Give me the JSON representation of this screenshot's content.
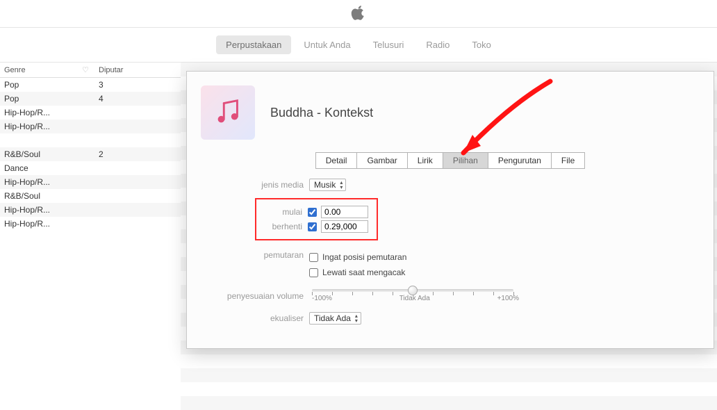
{
  "nav": {
    "items": [
      "Perpustakaan",
      "Untuk Anda",
      "Telusuri",
      "Radio",
      "Toko"
    ],
    "active_index": 0
  },
  "sidebar": {
    "columns": {
      "genre": "Genre",
      "heart": "♡",
      "plays": "Diputar"
    },
    "rows": [
      {
        "genre": "Pop",
        "plays": "3"
      },
      {
        "genre": "Pop",
        "plays": "4"
      },
      {
        "genre": "Hip-Hop/R...",
        "plays": ""
      },
      {
        "genre": "Hip-Hop/R...",
        "plays": ""
      },
      {
        "genre": "",
        "plays": ""
      },
      {
        "genre": "R&B/Soul",
        "plays": "2"
      },
      {
        "genre": "Dance",
        "plays": ""
      },
      {
        "genre": "Hip-Hop/R...",
        "plays": ""
      },
      {
        "genre": "R&B/Soul",
        "plays": ""
      },
      {
        "genre": "Hip-Hop/R...",
        "plays": ""
      },
      {
        "genre": "Hip-Hop/R...",
        "plays": ""
      }
    ]
  },
  "dialog": {
    "title": "Buddha - Kontekst",
    "tabs": [
      "Detail",
      "Gambar",
      "Lirik",
      "Pilihan",
      "Pengurutan",
      "File"
    ],
    "active_tab_index": 3,
    "media_kind_label": "jenis media",
    "media_kind_value": "Musik",
    "start_label": "mulai",
    "stop_label": "berhenti",
    "start_value": "0.00",
    "stop_value": "0.29,000",
    "playback_label": "pemutaran",
    "remember_label": "Ingat posisi pemutaran",
    "skip_label": "Lewati saat mengacak",
    "volume_label": "penyesuaian volume",
    "volume_min": "-100%",
    "volume_mid": "Tidak Ada",
    "volume_max": "+100%",
    "equalizer_label": "ekualiser",
    "equalizer_value": "Tidak Ada"
  }
}
